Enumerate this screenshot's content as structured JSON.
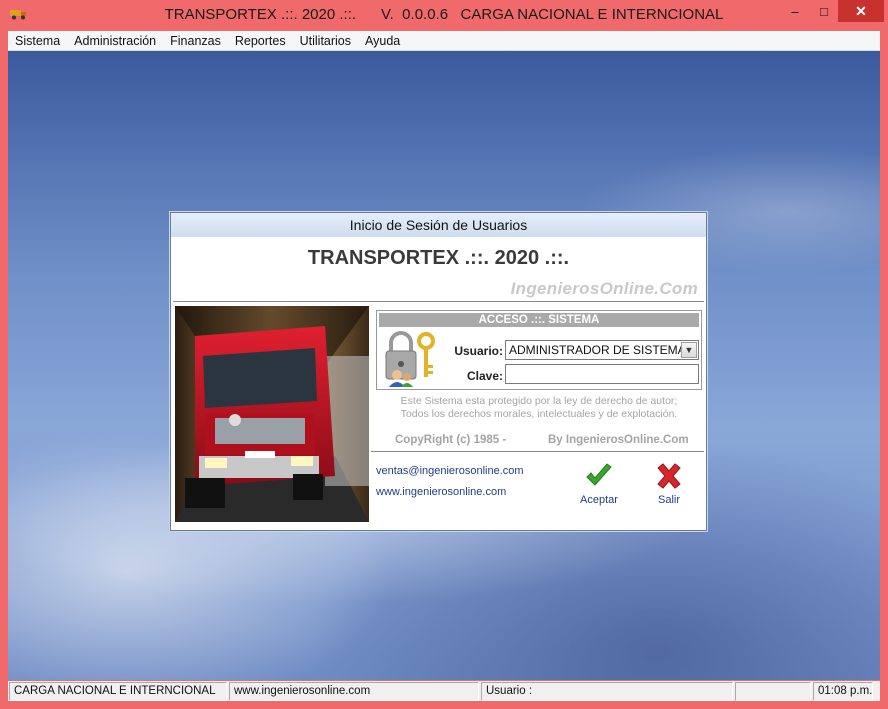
{
  "window": {
    "title": "TRANSPORTEX .::. 2020 .::.      V.  0.0.0.6   CARGA NACIONAL E INTERNCIONAL",
    "controls": {
      "minimize": "–",
      "maximize": "□",
      "close": "✕"
    }
  },
  "menu": {
    "items": [
      "Sistema",
      "Administración",
      "Finanzas",
      "Reportes",
      "Utilitarios",
      "Ayuda"
    ]
  },
  "dialog": {
    "title": "Inicio de Sesión de Usuarios",
    "brand": "TRANSPORTEX .::. 2020 .::.",
    "watermark": "IngenierosOnline.Com",
    "access_header": "ACCESO .::. SISTEMA",
    "user_label": "Usuario:",
    "user_value": "ADMINISTRADOR DE SISTEMA",
    "password_label": "Clave:",
    "password_value": "",
    "legal_line1": "Este Sistema esta protegido por la ley de derecho de autor;",
    "legal_line2": "Todos los derechos morales, intelectuales y de explotación.",
    "copyright": "CopyRight (c) 1985 -",
    "copyright_by": "By IngenierosOnline.Com",
    "email": "ventas@ingenierosonline.com",
    "website": "www.ingenierosonline.com",
    "accept_label": "Aceptar",
    "exit_label": "Salir"
  },
  "status": {
    "company": "CARGA NACIONAL E INTERNCIONAL",
    "website": "www.ingenierosonline.com",
    "user": "Usuario :",
    "extra": "",
    "time": "01:08 p.m."
  },
  "colors": {
    "frame": "#f0696b",
    "close_button": "#c7322f",
    "link_blue": "#1f3d86",
    "accept_green": "#3aa52e",
    "exit_red": "#d7262b"
  },
  "icons": {
    "app": "truck-icon",
    "lock": "lock-keys-users-icon",
    "accept": "checkmark-icon",
    "exit": "x-mark-icon",
    "dropdown": "chevron-down-icon"
  }
}
